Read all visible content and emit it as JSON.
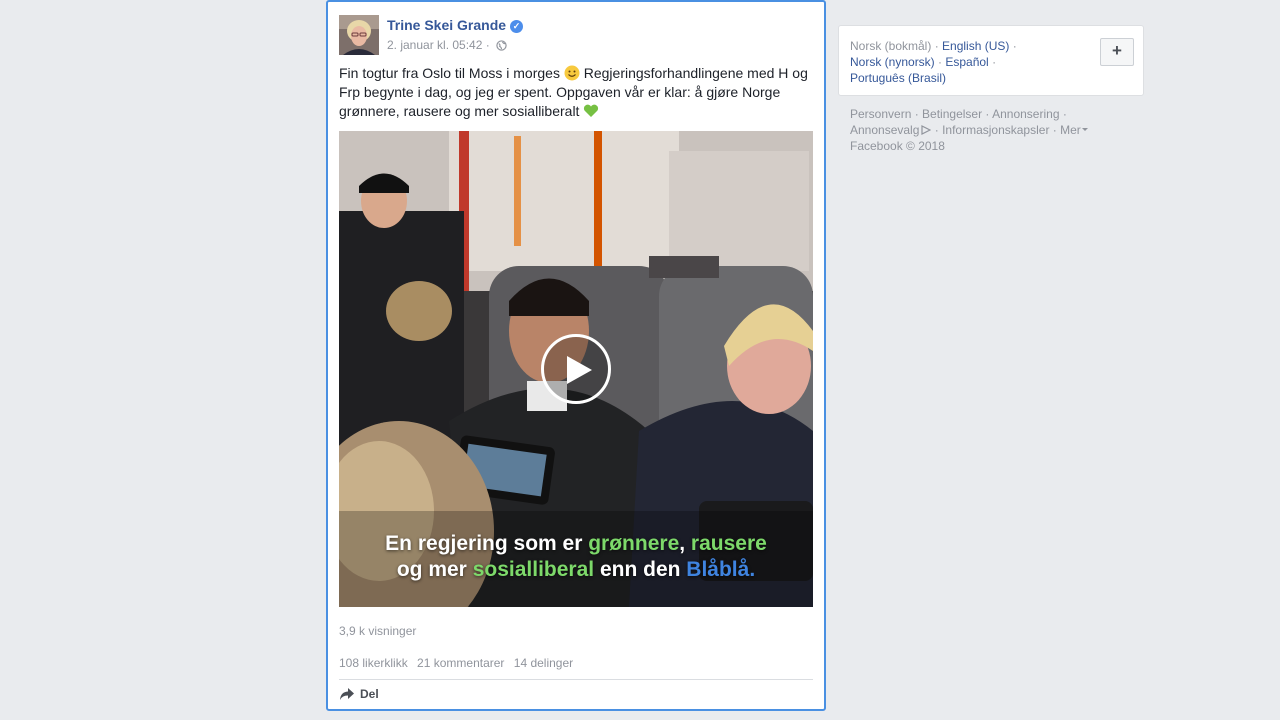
{
  "post": {
    "author": "Trine Skei Grande",
    "timestamp": "2. januar kl. 05:42 ·",
    "text": "Fin togtur fra Oslo til Moss i morges",
    "text_2": "Regjeringsforhandlingene med H og Frp begynte i dag, og jeg er spent. Oppgaven vår er klar: å gjøre Norge grønnere, rausere og mer sosialliberalt",
    "video": {
      "caption_line1": [
        "En regjering som er ",
        "grønnere",
        ", ",
        "rausere"
      ],
      "caption_line2": [
        "og mer ",
        "sosialliberal",
        " enn den ",
        "Blåblå."
      ],
      "caption_colors": {
        "green": "#7dd96a",
        "blue": "#3f84e0"
      }
    },
    "views": "3,9 k visninger",
    "likes": "108 likerklikk",
    "comments": "21 kommentarer",
    "shares": "14 delinger",
    "share_label": "Del"
  },
  "sidebar": {
    "languages": {
      "current": "Norsk (bokmål)",
      "options": [
        "English (US)",
        "Norsk (nynorsk)",
        "Español",
        "Português (Brasil)"
      ],
      "plus_label": "+"
    },
    "footer": {
      "links": [
        "Personvern",
        "Betingelser",
        "Annonsering",
        "Annonsevalg",
        "Informasjonskapsler",
        "Mer"
      ],
      "copyright": "Facebook © 2018"
    }
  },
  "colors": {
    "link": "#365899",
    "muted": "#90949c",
    "background": "#e9ebee",
    "focus_border": "#4a90e2"
  }
}
